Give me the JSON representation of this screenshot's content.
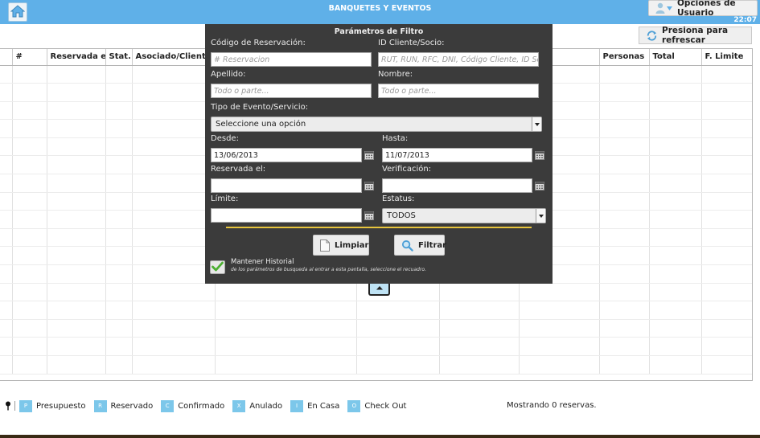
{
  "header": {
    "title": "BANQUETES Y EVENTOS",
    "user_menu_label": "Opciones de Usuario",
    "clock": "22:07",
    "home_icon": "home-icon",
    "bar_color": "#5fb0e8"
  },
  "toolbar": {
    "refresh_label": "Presiona para refrescar"
  },
  "table": {
    "columns": [
      "",
      "#",
      "Reservada el",
      "Stat.",
      "Asociado/Cliente",
      "",
      "",
      "",
      "",
      "Personas",
      "Total",
      "F. Limite"
    ]
  },
  "filter": {
    "title": "Parámetros de Filtro",
    "codigo_label": "Código de Reservación:",
    "codigo_placeholder": "# Reservacion",
    "id_label": "ID Cliente/Socio:",
    "id_placeholder": "RUT, RUN, RFC, DNI, Código Cliente, ID Socio",
    "apellido_label": "Apellido:",
    "apellido_placeholder": "Todo o parte...",
    "nombre_label": "Nombre:",
    "nombre_placeholder": "Todo o parte...",
    "tipo_label": "Tipo de Evento/Servicio:",
    "tipo_value": "Seleccione una opción",
    "desde_label": "Desde:",
    "desde_value": "13/06/2013",
    "hasta_label": "Hasta:",
    "hasta_value": "11/07/2013",
    "reservada_label": "Reservada el:",
    "reservada_value": "",
    "verificacion_label": "Verificación:",
    "verificacion_value": "",
    "limite_label": "Límite:",
    "limite_value": "",
    "estatus_label": "Estatus:",
    "estatus_value": "TODOS",
    "clear_label": "Limpiar",
    "filter_label": "Filtrar",
    "history_title": "Mantener Historial",
    "history_note": "de los parámetros de busqueda al entrar a esta pantalla, seleccione el recuadro.",
    "history_checked": true,
    "separator_color": "#e7c43d"
  },
  "legend": {
    "items": [
      {
        "code": "P",
        "label": "Presupuesto"
      },
      {
        "code": "R",
        "label": "Reservado"
      },
      {
        "code": "C",
        "label": "Confirmado"
      },
      {
        "code": "X",
        "label": "Anulado"
      },
      {
        "code": "I",
        "label": "En Casa"
      },
      {
        "code": "O",
        "label": "Check Out"
      }
    ],
    "color": "#7cc7ea"
  },
  "status": {
    "showing_text": "Mostrando 0 reservas."
  }
}
